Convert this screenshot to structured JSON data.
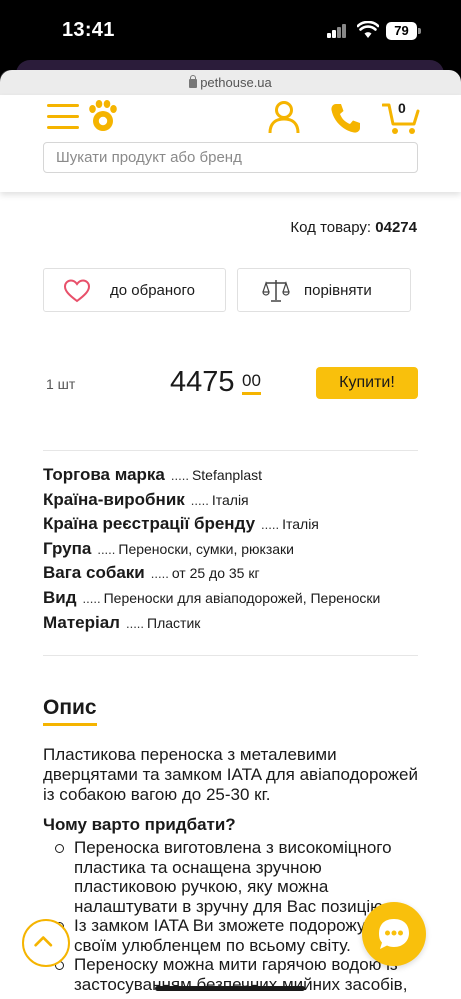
{
  "status_bar": {
    "time": "13:41",
    "battery": "79"
  },
  "browser": {
    "url": "pethouse.ua"
  },
  "header": {
    "cart_count": "0",
    "search_placeholder": "Шукати продукт або бренд",
    "icons": [
      "menu-icon",
      "paw-logo-icon",
      "user-icon",
      "phone-icon",
      "cart-icon"
    ]
  },
  "product": {
    "code_label": "Код товару:",
    "code_value": "04274",
    "favorite_label": "до обраного",
    "compare_label": "порівняти",
    "quantity": "1 шт",
    "price_main": "4475",
    "price_cents": "00",
    "buy_label": "Купити!"
  },
  "specs": [
    {
      "key": "Торгова марка",
      "dots": ".....",
      "value": "Stefanplast"
    },
    {
      "key": "Країна-виробник",
      "dots": ".....",
      "value": "Італія"
    },
    {
      "key": "Країна реєстрації бренду",
      "dots": ".....",
      "value": "Італія"
    },
    {
      "key": "Група",
      "dots": ".....",
      "value": "Переноски, сумки, рюкзаки"
    },
    {
      "key": "Вага собаки",
      "dots": ".....",
      "value": "от 25 до 35 кг"
    },
    {
      "key": "Вид",
      "dots": ".....",
      "value": "Переноски для авіаподорожей, Переноски"
    },
    {
      "key": "Матеріал",
      "dots": ".....",
      "value": "Пластик"
    }
  ],
  "description": {
    "title": "Опис",
    "text": "Пластикова переноска з металевими дверцятами та замком IATA для авіаподорожей із собакою вагою до 25-30 кг.",
    "why_title": "Чому варто придбати?",
    "bullets": [
      "Переноска виготовлена з високоміцного пластика та оснащена зручною пластиковою ручкою, яку можна налаштувати в зручну для Вас позицію.",
      "Із замком IATA Ви зможете подорожувати зі своїм улюбленцем по всьому світу.",
      "Переноску можна мити гарячою водою із застосуванням безпечних мийних засобів,"
    ]
  },
  "colors": {
    "accent": "#f9c00c",
    "text": "#1a1a1a"
  }
}
